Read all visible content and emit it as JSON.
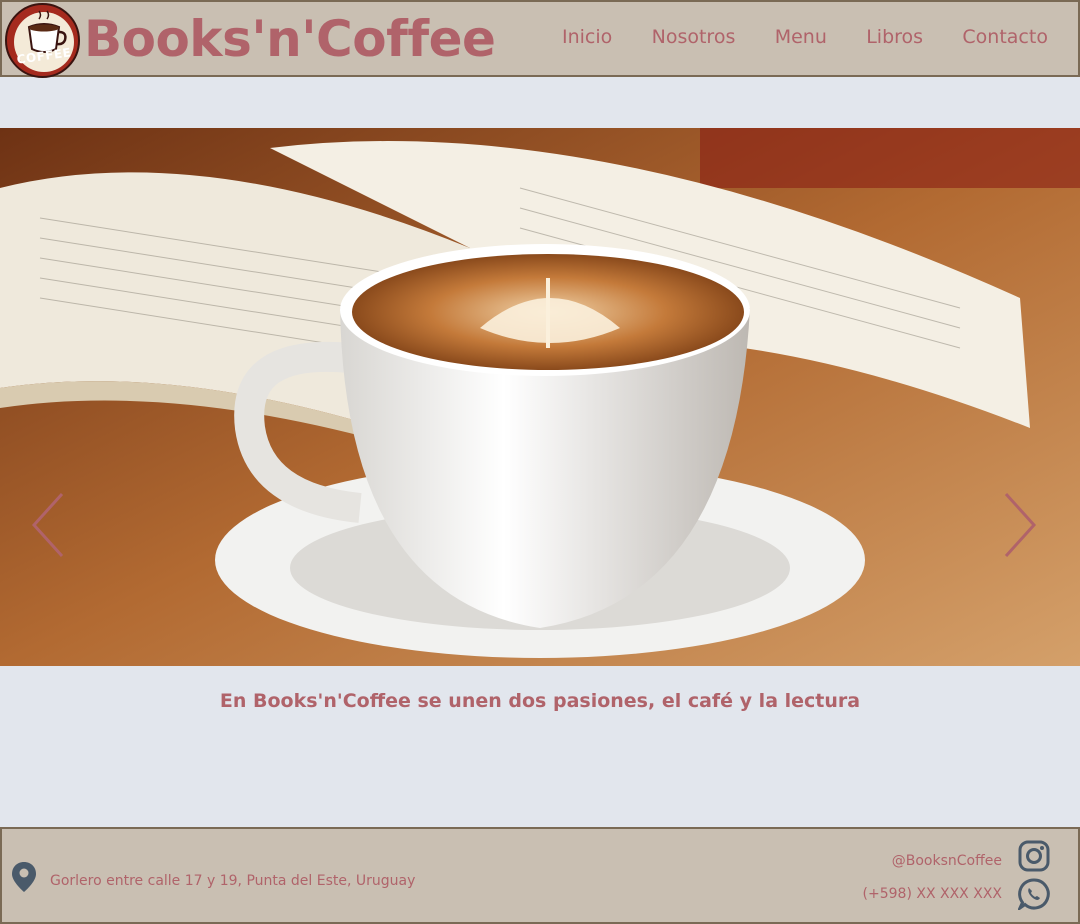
{
  "header": {
    "brand": "Books'n'Coffee",
    "logo_text": "COFFEE",
    "nav": [
      "Inicio",
      "Nosotros",
      "Menu",
      "Libros",
      "Contacto"
    ]
  },
  "carousel": {
    "image_icon": "coffee-book-photo",
    "prev_icon": "chevron-left-icon",
    "next_icon": "chevron-right-icon"
  },
  "tagline": "En Books'n'Coffee se unen dos pasiones, el café y la lectura",
  "footer": {
    "address": "Gorlero entre calle 17 y 19, Punta del Este, Uruguay",
    "instagram": "@BooksnCoffee",
    "whatsapp": "(+598) XX XXX XXX"
  },
  "colors": {
    "accent": "#b0636a",
    "bar": "#c9bfb2",
    "border": "#7a6a55",
    "background": "#e2e6ed",
    "icon": "#4a5a6a"
  }
}
